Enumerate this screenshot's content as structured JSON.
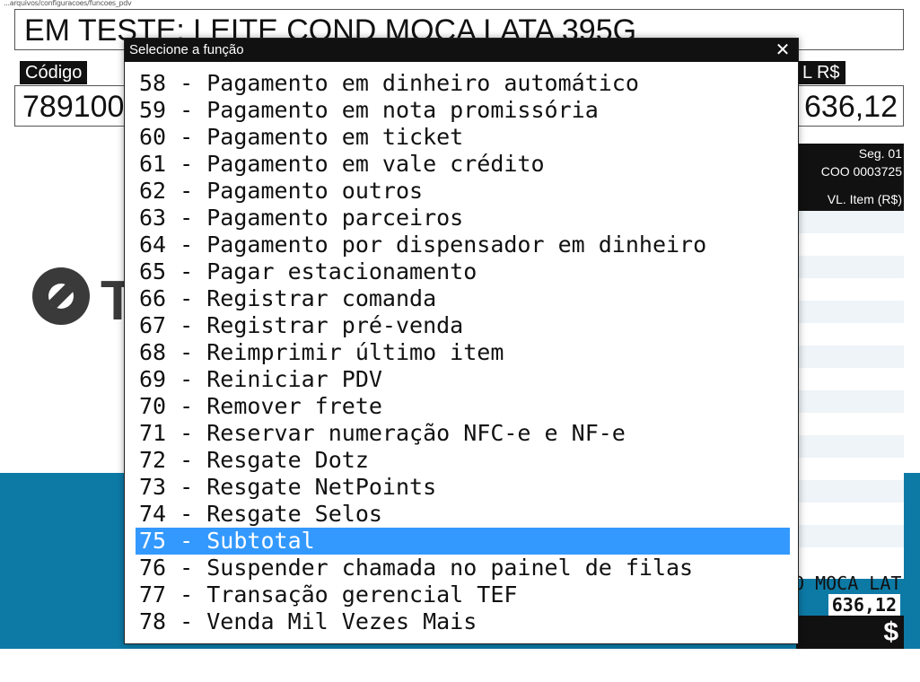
{
  "window": {
    "path_text": "...arquivos/configuracoes/funcoes_pdv"
  },
  "product": {
    "description": "EM TESTE: LEITE COND MOCA LATA 395G"
  },
  "code": {
    "label": "Código",
    "value": "789100"
  },
  "total": {
    "label": "L R$",
    "value": "636,12"
  },
  "receipt": {
    "segment": "Seg. 01",
    "coo": "COO 0003725",
    "vl_item_header": "VL. Item (R$)",
    "last_item_desc": "O MOCA LAT",
    "last_item_value": "636,12",
    "grand_total": "$ 636,12"
  },
  "brand": {
    "logo_letter": "T"
  },
  "dialog": {
    "title": "Selecione a função",
    "close_symbol": "✕",
    "items": [
      "58 - Pagamento em dinheiro automático",
      "59 - Pagamento em nota promissória",
      "60 - Pagamento em ticket",
      "61 - Pagamento em vale crédito",
      "62 - Pagamento outros",
      "63 - Pagamento parceiros",
      "64 - Pagamento por dispensador em dinheiro",
      "65 - Pagar estacionamento",
      "66 - Registrar comanda",
      "67 - Registrar pré-venda",
      "68 - Reimprimir último item",
      "69 - Reiniciar PDV",
      "70 - Remover frete",
      "71 - Reservar numeração NFC-e e NF-e",
      "72 - Resgate Dotz",
      "73 - Resgate NetPoints",
      "74 - Resgate Selos",
      "75 - Subtotal",
      "76 - Suspender chamada no painel de filas",
      "77 - Transação gerencial TEF",
      "78 - Venda Mil Vezes Mais"
    ],
    "selected_index": 17
  },
  "colors": {
    "highlight": "#3399ff",
    "brand_blue": "#0d7aa6",
    "title_bar": "#111111"
  }
}
